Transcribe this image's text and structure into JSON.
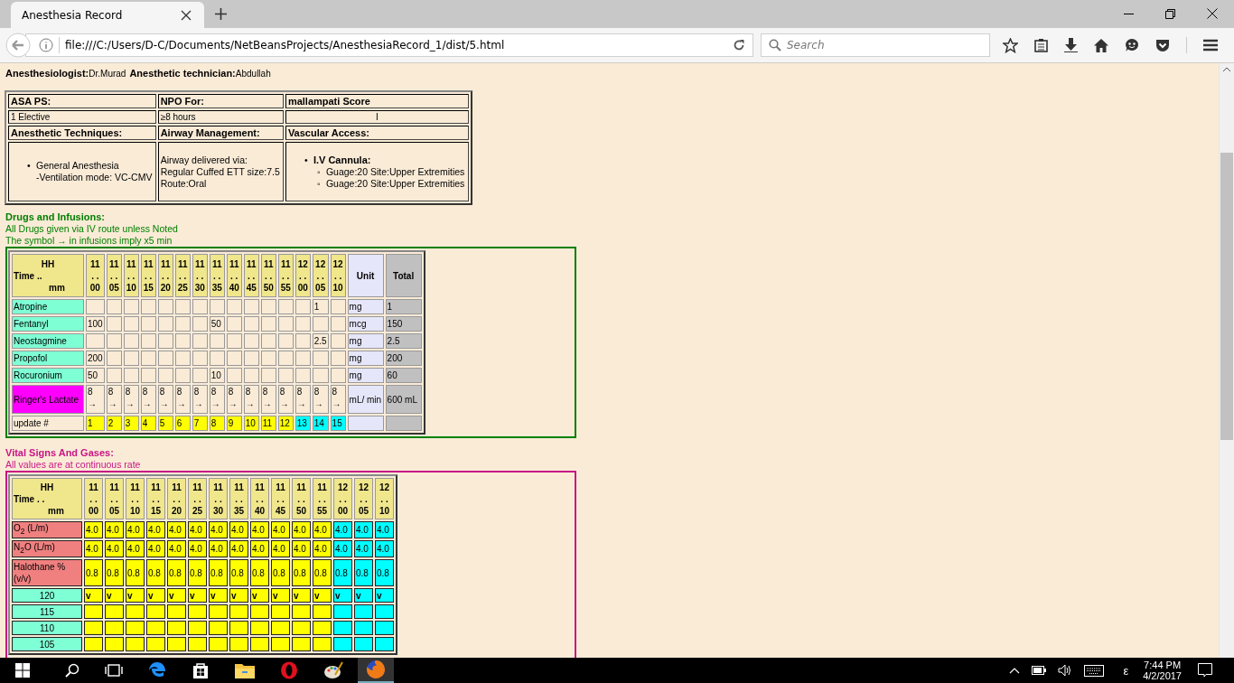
{
  "browser": {
    "tab_title": "Anesthesia Record",
    "url": "file:///C:/Users/D-C/Documents/NetBeansProjects/AnesthesiaRecord_1/dist/5.html",
    "search_placeholder": "Search"
  },
  "staff": [
    {
      "label": "Anesthesiologist:",
      "value": "Dr.Murad"
    },
    {
      "label": "Anesthetic technician:",
      "value": "Abdullah"
    }
  ],
  "info_table": {
    "rows": [
      [
        {
          "kind": "heading",
          "text": "ASA PS:"
        },
        {
          "kind": "heading",
          "text": "NPO For:"
        },
        {
          "kind": "heading",
          "text": "mallampati Score"
        }
      ],
      [
        {
          "kind": "text",
          "text": "1 Elective"
        },
        {
          "kind": "text",
          "text": "≥8 hours"
        },
        {
          "kind": "centered",
          "text": "I"
        }
      ],
      [
        {
          "kind": "heading",
          "text": "Anesthetic Techniques:"
        },
        {
          "kind": "heading",
          "text": "Airway Management:"
        },
        {
          "kind": "heading",
          "text": "Vascular Access:"
        }
      ],
      [
        {
          "kind": "bullets",
          "items": [
            {
              "marker": "•",
              "lines": [
                "General Anesthesia",
                "-Ventilation mode: VC-CMV"
              ]
            }
          ]
        },
        {
          "kind": "lines",
          "lines": [
            "Airway delivered via:",
            "Regular Cuffed ETT size:7.5",
            "Route:Oral"
          ]
        },
        {
          "kind": "group",
          "marker": "•",
          "title": "I.V Cannula:",
          "children": [
            {
              "marker": "◦",
              "text": "Guage:20 Site:Upper Extremities"
            },
            {
              "marker": "◦",
              "text": "Guage:20 Site:Upper Extremities"
            }
          ]
        }
      ]
    ]
  },
  "drugs": {
    "title": "Drugs and Infusions:",
    "notes": [
      "All Drugs given via IV route unless Noted",
      "The symbol → in infusions imply x5 min"
    ],
    "corner": {
      "top": "HH",
      "middle": "Time  ..",
      "bottom": "mm"
    },
    "columns": [
      {
        "hh": "11",
        "sep": ". .",
        "mm": "00"
      },
      {
        "hh": "11",
        "sep": ". .",
        "mm": "05"
      },
      {
        "hh": "11",
        "sep": ". .",
        "mm": "10"
      },
      {
        "hh": "11",
        "sep": ". .",
        "mm": "15"
      },
      {
        "hh": "11",
        "sep": ". .",
        "mm": "20"
      },
      {
        "hh": "11",
        "sep": ". .",
        "mm": "25"
      },
      {
        "hh": "11",
        "sep": ". .",
        "mm": "30"
      },
      {
        "hh": "11",
        "sep": ". .",
        "mm": "35"
      },
      {
        "hh": "11",
        "sep": ". .",
        "mm": "40"
      },
      {
        "hh": "11",
        "sep": ". .",
        "mm": "45"
      },
      {
        "hh": "11",
        "sep": ". .",
        "mm": "50"
      },
      {
        "hh": "11",
        "sep": ". .",
        "mm": "55"
      },
      {
        "hh": "12",
        "sep": ". .",
        "mm": "00"
      },
      {
        "hh": "12",
        "sep": ". .",
        "mm": "05"
      },
      {
        "hh": "12",
        "sep": ". .",
        "mm": "10"
      }
    ],
    "unit_heading": "Unit",
    "total_heading": "Total",
    "rows": [
      {
        "kind": "dose",
        "name": "Atropine",
        "color": "#7fffd4",
        "values": [
          {
            "kind": "empty"
          },
          {
            "kind": "empty"
          },
          {
            "kind": "empty"
          },
          {
            "kind": "empty"
          },
          {
            "kind": "empty"
          },
          {
            "kind": "empty"
          },
          {
            "kind": "empty"
          },
          {
            "kind": "empty"
          },
          {
            "kind": "empty"
          },
          {
            "kind": "empty"
          },
          {
            "kind": "empty"
          },
          {
            "kind": "empty"
          },
          {
            "kind": "empty"
          },
          {
            "kind": "dose",
            "text": "1"
          },
          {
            "kind": "empty"
          }
        ],
        "unit": "mg",
        "total": "1"
      },
      {
        "kind": "dose",
        "name": "Fentanyl",
        "color": "#7fffd4",
        "values": [
          {
            "kind": "dose",
            "text": "100"
          },
          {
            "kind": "empty"
          },
          {
            "kind": "empty"
          },
          {
            "kind": "empty"
          },
          {
            "kind": "empty"
          },
          {
            "kind": "empty"
          },
          {
            "kind": "empty"
          },
          {
            "kind": "dose",
            "text": "50"
          },
          {
            "kind": "empty"
          },
          {
            "kind": "empty"
          },
          {
            "kind": "empty"
          },
          {
            "kind": "empty"
          },
          {
            "kind": "empty"
          },
          {
            "kind": "empty"
          },
          {
            "kind": "empty"
          }
        ],
        "unit": "mcg",
        "total": "150"
      },
      {
        "kind": "dose",
        "name": "Neostagmine",
        "color": "#7fffd4",
        "values": [
          {
            "kind": "empty"
          },
          {
            "kind": "empty"
          },
          {
            "kind": "empty"
          },
          {
            "kind": "empty"
          },
          {
            "kind": "empty"
          },
          {
            "kind": "empty"
          },
          {
            "kind": "empty"
          },
          {
            "kind": "empty"
          },
          {
            "kind": "empty"
          },
          {
            "kind": "empty"
          },
          {
            "kind": "empty"
          },
          {
            "kind": "empty"
          },
          {
            "kind": "empty"
          },
          {
            "kind": "dose",
            "text": "2.5"
          },
          {
            "kind": "empty"
          }
        ],
        "unit": "mg",
        "total": "2.5"
      },
      {
        "kind": "dose",
        "name": "Propofol",
        "color": "#7fffd4",
        "values": [
          {
            "kind": "dose",
            "text": "200"
          },
          {
            "kind": "empty"
          },
          {
            "kind": "empty"
          },
          {
            "kind": "empty"
          },
          {
            "kind": "empty"
          },
          {
            "kind": "empty"
          },
          {
            "kind": "empty"
          },
          {
            "kind": "empty"
          },
          {
            "kind": "empty"
          },
          {
            "kind": "empty"
          },
          {
            "kind": "empty"
          },
          {
            "kind": "empty"
          },
          {
            "kind": "empty"
          },
          {
            "kind": "empty"
          },
          {
            "kind": "empty"
          }
        ],
        "unit": "mg",
        "total": "200"
      },
      {
        "kind": "dose",
        "name": "Rocuronium",
        "color": "#7fffd4",
        "values": [
          {
            "kind": "dose",
            "text": "50"
          },
          {
            "kind": "empty"
          },
          {
            "kind": "empty"
          },
          {
            "kind": "empty"
          },
          {
            "kind": "empty"
          },
          {
            "kind": "empty"
          },
          {
            "kind": "empty"
          },
          {
            "kind": "dose",
            "text": "10"
          },
          {
            "kind": "empty"
          },
          {
            "kind": "empty"
          },
          {
            "kind": "empty"
          },
          {
            "kind": "empty"
          },
          {
            "kind": "empty"
          },
          {
            "kind": "empty"
          },
          {
            "kind": "empty"
          }
        ],
        "unit": "mg",
        "total": "60"
      },
      {
        "kind": "infusion",
        "name": "Ringer's Lactate",
        "color": "#ff00ff",
        "values": [
          {
            "rate": "8",
            "arrow": "→"
          },
          {
            "rate": "8",
            "arrow": "→"
          },
          {
            "rate": "8",
            "arrow": "→"
          },
          {
            "rate": "8",
            "arrow": "→"
          },
          {
            "rate": "8",
            "arrow": "→"
          },
          {
            "rate": "8",
            "arrow": "→"
          },
          {
            "rate": "8",
            "arrow": "→"
          },
          {
            "rate": "8",
            "arrow": "→"
          },
          {
            "rate": "8",
            "arrow": "→"
          },
          {
            "rate": "8",
            "arrow": "→"
          },
          {
            "rate": "8",
            "arrow": "→"
          },
          {
            "rate": "8",
            "arrow": "→"
          },
          {
            "rate": "8",
            "arrow": "→"
          },
          {
            "rate": "8",
            "arrow": "→"
          },
          {
            "rate": "8",
            "arrow": "→"
          }
        ],
        "unit": "mL/ min",
        "total": "600 mL"
      }
    ],
    "update_row": {
      "label": "update #",
      "cells": [
        {
          "text": "1",
          "color": "#ffff00"
        },
        {
          "text": "2",
          "color": "#ffff00"
        },
        {
          "text": "3",
          "color": "#ffff00"
        },
        {
          "text": "4",
          "color": "#ffff00"
        },
        {
          "text": "5",
          "color": "#ffff00"
        },
        {
          "text": "6",
          "color": "#ffff00"
        },
        {
          "text": "7",
          "color": "#ffff00"
        },
        {
          "text": "8",
          "color": "#ffff00"
        },
        {
          "text": "9",
          "color": "#ffff00"
        },
        {
          "text": "10",
          "color": "#ffff00"
        },
        {
          "text": "11",
          "color": "#ffff00"
        },
        {
          "text": "12",
          "color": "#ffff00"
        },
        {
          "text": "13",
          "color": "#00ffff"
        },
        {
          "text": "14",
          "color": "#00ffff"
        },
        {
          "text": "15",
          "color": "#00ffff"
        }
      ]
    }
  },
  "vitals": {
    "title": "Vital Signs And Gases:",
    "note": "All values are at continuous rate",
    "corner": {
      "top": "HH",
      "middle": "Time  . .",
      "bottom": "mm"
    },
    "columns": [
      {
        "hh": "11",
        "sep": ". .",
        "mm": "00",
        "color": "#ffff00"
      },
      {
        "hh": "11",
        "sep": ". .",
        "mm": "05",
        "color": "#ffff00"
      },
      {
        "hh": "11",
        "sep": ". .",
        "mm": "10",
        "color": "#ffff00"
      },
      {
        "hh": "11",
        "sep": ". .",
        "mm": "15",
        "color": "#ffff00"
      },
      {
        "hh": "11",
        "sep": ". .",
        "mm": "20",
        "color": "#ffff00"
      },
      {
        "hh": "11",
        "sep": ". .",
        "mm": "25",
        "color": "#ffff00"
      },
      {
        "hh": "11",
        "sep": ". .",
        "mm": "30",
        "color": "#ffff00"
      },
      {
        "hh": "11",
        "sep": ". .",
        "mm": "35",
        "color": "#ffff00"
      },
      {
        "hh": "11",
        "sep": ". .",
        "mm": "40",
        "color": "#ffff00"
      },
      {
        "hh": "11",
        "sep": ". .",
        "mm": "45",
        "color": "#ffff00"
      },
      {
        "hh": "11",
        "sep": ". .",
        "mm": "50",
        "color": "#ffff00"
      },
      {
        "hh": "11",
        "sep": ". .",
        "mm": "55",
        "color": "#ffff00"
      },
      {
        "hh": "12",
        "sep": ". .",
        "mm": "00",
        "color": "#00ffff"
      },
      {
        "hh": "12",
        "sep": ". .",
        "mm": "05",
        "color": "#00ffff"
      },
      {
        "hh": "12",
        "sep": ". .",
        "mm": "10",
        "color": "#00ffff"
      }
    ],
    "rows": [
      {
        "kind": "gas",
        "label": "O$_{2}$ (L/m)",
        "color": "#f08080",
        "values": [
          "4.0",
          "4.0",
          "4.0",
          "4.0",
          "4.0",
          "4.0",
          "4.0",
          "4.0",
          "4.0",
          "4.0",
          "4.0",
          "4.0",
          "4.0",
          "4.0",
          "4.0"
        ]
      },
      {
        "kind": "gas",
        "label": "N$_{2}$O (L/m)",
        "color": "#f08080",
        "values": [
          "4.0",
          "4.0",
          "4.0",
          "4.0",
          "4.0",
          "4.0",
          "4.0",
          "4.0",
          "4.0",
          "4.0",
          "4.0",
          "4.0",
          "4.0",
          "4.0",
          "4.0"
        ]
      },
      {
        "kind": "gas",
        "label": "Halothane %(v/v)",
        "color": "#f08080",
        "values": [
          "0.8",
          "0.8",
          "0.8",
          "0.8",
          "0.8",
          "0.8",
          "0.8",
          "0.8",
          "0.8",
          "0.8",
          "0.8",
          "0.8",
          "0.8",
          "0.8",
          "0.8"
        ]
      },
      {
        "kind": "scale",
        "label": "120",
        "color": "#7fffd4",
        "values": [
          "v",
          "v",
          "v",
          "v",
          "v",
          "v",
          "v",
          "v",
          "v",
          "v",
          "v",
          "v",
          "v",
          "v",
          "v"
        ]
      },
      {
        "kind": "scale",
        "label": "115",
        "color": "#7fffd4"
      },
      {
        "kind": "scale",
        "label": "110",
        "color": "#7fffd4"
      },
      {
        "kind": "scale",
        "label": "105",
        "color": "#7fffd4"
      }
    ]
  },
  "taskbar": {
    "language": "ε",
    "time": "7:44 PM",
    "date": "4/2/2017"
  }
}
